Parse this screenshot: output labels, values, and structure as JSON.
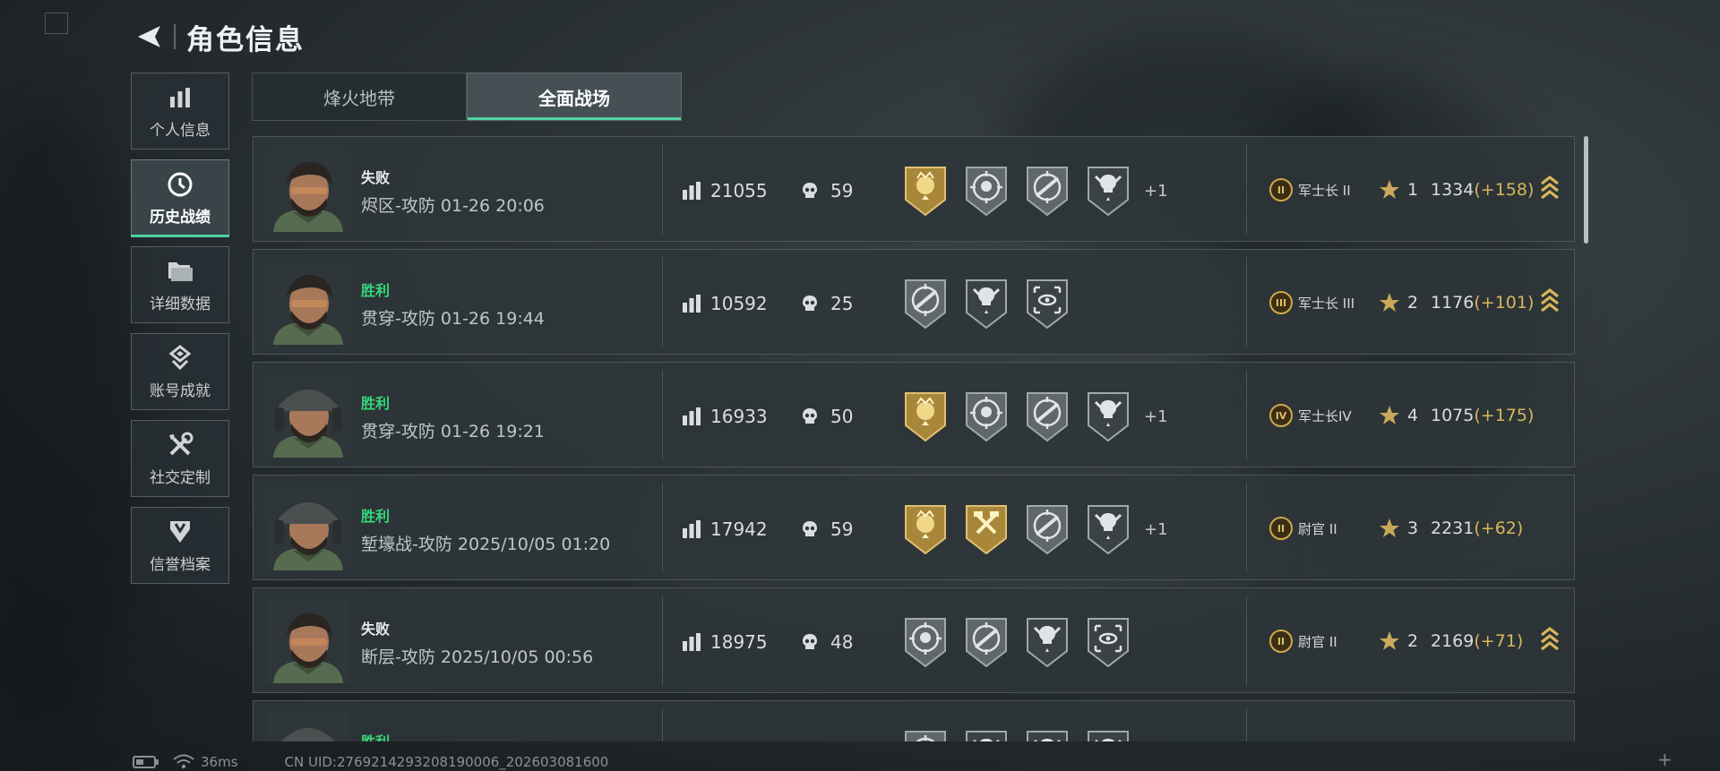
{
  "header": {
    "title": "角色信息",
    "back_icon": "back-arrow-icon"
  },
  "sidebar": {
    "items": [
      {
        "label": "个人信息",
        "icon": "bar-chart-icon",
        "active": false
      },
      {
        "label": "历史战绩",
        "icon": "clock-icon",
        "active": true
      },
      {
        "label": "详细数据",
        "icon": "folder-icon",
        "active": false
      },
      {
        "label": "账号成就",
        "icon": "achievement-icon",
        "active": false
      },
      {
        "label": "社交定制",
        "icon": "tools-icon",
        "active": false
      },
      {
        "label": "信誉档案",
        "icon": "shield-icon",
        "active": false
      }
    ]
  },
  "tabs": [
    {
      "label": "烽火地带",
      "active": false
    },
    {
      "label": "全面战场",
      "active": true
    }
  ],
  "matches": [
    {
      "result": "失败",
      "outcome": "lose",
      "map_time": "烬区-攻防 01-26 20:06",
      "score": "21055",
      "kills": "59",
      "medals": [
        "gold-crown",
        "target-skull",
        "target-rifle",
        "skull-star"
      ],
      "extra": "+1",
      "rank_icon": "II",
      "rank": "军士长 II",
      "level": "1",
      "points": "1334",
      "delta": "(+158)",
      "promoted": true
    },
    {
      "result": "胜利",
      "outcome": "win",
      "map_time": "贯穿-攻防 01-26 19:44",
      "score": "10592",
      "kills": "25",
      "medals": [
        "target-rifle",
        "skull-star",
        "eye-scope"
      ],
      "extra": "",
      "rank_icon": "III",
      "rank": "军士长 III",
      "level": "2",
      "points": "1176",
      "delta": "(+101)",
      "promoted": true
    },
    {
      "result": "胜利",
      "outcome": "win",
      "map_time": "贯穿-攻防 01-26 19:21",
      "score": "16933",
      "kills": "50",
      "medals": [
        "gold-crown",
        "target-skull",
        "target-rifle",
        "skull-star"
      ],
      "extra": "+1",
      "rank_icon": "IV",
      "rank": "军士长IV",
      "level": "4",
      "points": "1075",
      "delta": "(+175)",
      "promoted": false
    },
    {
      "result": "胜利",
      "outcome": "win",
      "map_time": "堑壕战-攻防 2025/10/05 01:20",
      "score": "17942",
      "kills": "59",
      "medals": [
        "gold-crown",
        "gold-hammer",
        "target-rifle",
        "skull-star"
      ],
      "extra": "+1",
      "rank_icon": "II",
      "rank": "尉官 II",
      "level": "3",
      "points": "2231",
      "delta": "(+62)",
      "promoted": false
    },
    {
      "result": "失败",
      "outcome": "lose",
      "map_time": "断层-攻防 2025/10/05 00:56",
      "score": "18975",
      "kills": "48",
      "medals": [
        "target-skull",
        "target-rifle",
        "skull-star",
        "eye-scope"
      ],
      "extra": "",
      "rank_icon": "II",
      "rank": "尉官 II",
      "level": "2",
      "points": "2169",
      "delta": "(+71)",
      "promoted": true
    },
    {
      "result": "胜利",
      "outcome": "win",
      "map_time": "",
      "score": "",
      "kills": "",
      "medals": [
        "target-skull",
        "skull-star",
        "skull-star",
        "skull-star"
      ],
      "extra": "",
      "rank_icon": "",
      "rank": "",
      "level": "",
      "points": "",
      "delta": "",
      "promoted": false
    }
  ],
  "footer": {
    "ping": "36ms",
    "uid": "CN UID:276921429320819000​6_202603081600"
  },
  "colors": {
    "win": "#37d77a",
    "accent": "#4fd3a1",
    "gold": "#d8b65a"
  }
}
